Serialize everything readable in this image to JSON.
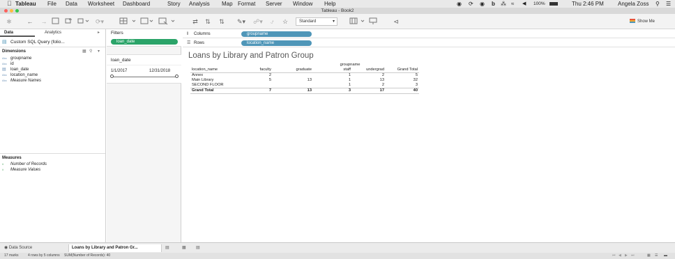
{
  "menubar": {
    "app": "Tableau",
    "items": [
      "File",
      "Data",
      "Worksheet",
      "Dashboard",
      "Story",
      "Analysis",
      "Map",
      "Format",
      "Server",
      "Window",
      "Help"
    ],
    "battery": "100%",
    "clock": "Thu 2:46 PM",
    "user": "Angela Zoss"
  },
  "window": {
    "title": "Tableau - Book2"
  },
  "toolbar": {
    "fit_mode": "Standard",
    "show_me": "Show Me"
  },
  "data_pane": {
    "tabs": [
      "Data",
      "Analytics"
    ],
    "datasource": "Custom SQL Query (folio...",
    "dimensions_label": "Dimensions",
    "dimensions": [
      {
        "type": "Abc",
        "name": "groupname",
        "italic": false
      },
      {
        "type": "Abc",
        "name": "id",
        "italic": false
      },
      {
        "type": "date",
        "name": "loan_date",
        "italic": false
      },
      {
        "type": "Abc",
        "name": "location_name",
        "italic": false
      },
      {
        "type": "Abc",
        "name": "Measure Names",
        "italic": true
      }
    ],
    "measures_label": "Measures",
    "measures": [
      {
        "type": "#",
        "name": "Number of Records"
      },
      {
        "type": "#",
        "name": "Measure Values"
      }
    ]
  },
  "filters": {
    "title": "Filters",
    "pills": [
      "loan_date"
    ],
    "card": {
      "title": "loan_date",
      "start": "1/1/2017",
      "end": "12/31/2018"
    }
  },
  "shelves": {
    "columns_label": "Columns",
    "columns_pill": "groupname",
    "rows_label": "Rows",
    "rows_pill": "location_name"
  },
  "view": {
    "title": "Loans by Library and Patron Group",
    "col_header": "groupname",
    "row_header": "location_name",
    "columns": [
      "faculty",
      "graduate",
      "staff",
      "undergrad",
      "Grand Total"
    ],
    "rows": [
      {
        "label": "Annex",
        "values": [
          "2",
          "",
          "1",
          "2",
          "5"
        ]
      },
      {
        "label": "Main Library",
        "values": [
          "5",
          "13",
          "1",
          "13",
          "32"
        ]
      },
      {
        "label": "SECOND FLOOR",
        "values": [
          "",
          "",
          "1",
          "2",
          "3"
        ]
      }
    ],
    "total": {
      "label": "Grand Total",
      "values": [
        "7",
        "13",
        "3",
        "17",
        "40"
      ]
    }
  },
  "bottom_tabs": {
    "datasource": "Data Source",
    "sheet": "Loans by Library and Patron Gr..."
  },
  "status": {
    "marks": "17 marks",
    "dims": "4 rows by 5 columns",
    "sum": "SUM(Number of Records): 40"
  }
}
